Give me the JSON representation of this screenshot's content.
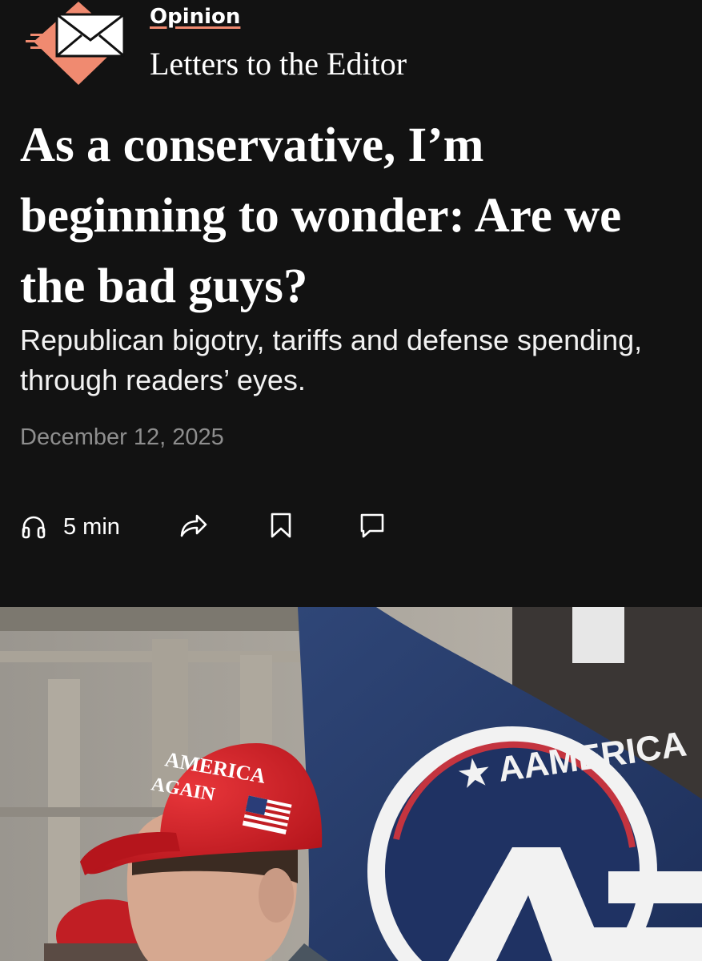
{
  "header": {
    "section": "Opinion",
    "series": "Letters to the Editor"
  },
  "article": {
    "headline": "As a conservative, I’m beginning to wonder: Are we the bad guys?",
    "dek": "Republican bigotry, tariffs and defense spending, through readers’ eyes.",
    "date": "December 12, 2025"
  },
  "actions": {
    "listen_duration": "5 min",
    "icons": [
      "headphones-icon",
      "share-icon",
      "bookmark-icon",
      "comment-icon"
    ]
  },
  "hero_image": {
    "hat_text_line1": "AMERICA",
    "hat_text_line2": "AGAIN",
    "flag_text": "AMERICA"
  },
  "colors": {
    "background": "#121212",
    "accent": "#f08a70",
    "date_gray": "#8e8e8e"
  }
}
